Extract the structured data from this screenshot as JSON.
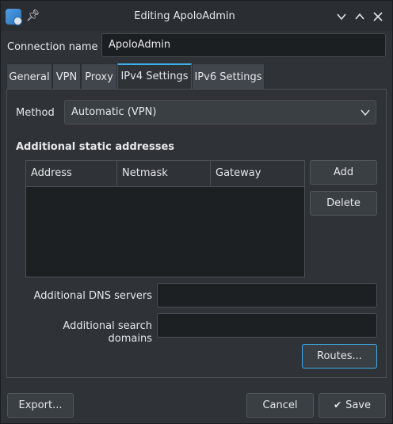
{
  "window": {
    "title": "Editing ApoloAdmin"
  },
  "connection": {
    "label": "Connection name",
    "value": "ApoloAdmin"
  },
  "tabs": [
    {
      "label": "General"
    },
    {
      "label": "VPN"
    },
    {
      "label": "Proxy"
    },
    {
      "label": "IPv4 Settings",
      "active": true
    },
    {
      "label": "IPv6 Settings"
    }
  ],
  "ipv4": {
    "method_label": "Method",
    "method_value": "Automatic (VPN)",
    "section_title": "Additional static addresses",
    "columns": [
      "Address",
      "Netmask",
      "Gateway"
    ],
    "add_label": "Add",
    "delete_label": "Delete",
    "dns_label": "Additional DNS servers",
    "search_label": "Additional search domains",
    "routes_label": "Routes..."
  },
  "footer": {
    "export_label": "Export...",
    "cancel_label": "Cancel",
    "save_label": "Save"
  },
  "colors": {
    "accent": "#3daee9",
    "background": "#2f3338"
  }
}
